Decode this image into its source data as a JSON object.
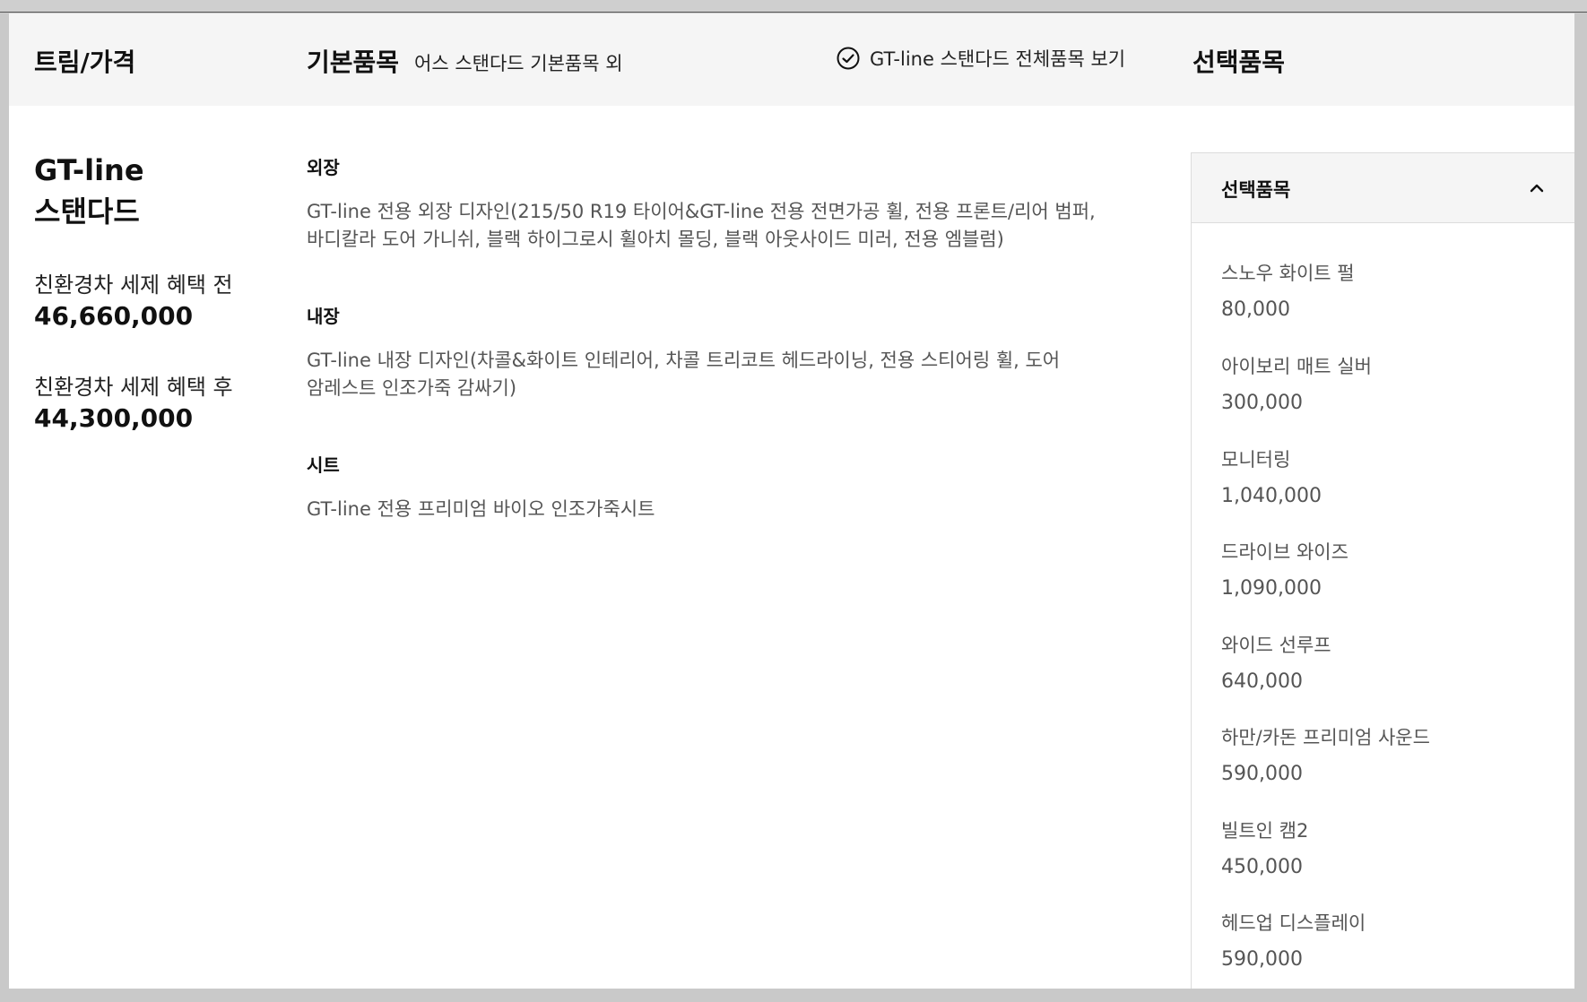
{
  "header": {
    "trim_price": "트림/가격",
    "basic_items": "기본품목",
    "basic_items_sub": "어스 스탠다드 기본품목 외",
    "view_all": "GT-line 스탠다드 전체품목 보기",
    "optional_items": "선택품목"
  },
  "trim": {
    "name_line1": "GT-line",
    "name_line2": "스탠다드",
    "before_label": "친환경차 세제 혜택 전",
    "before_price": "46,660,000",
    "after_label": "친환경차 세제 혜택 후",
    "after_price": "44,300,000"
  },
  "basic": {
    "categories": [
      {
        "title": "외장",
        "line1": "GT-line 전용 외장 디자인(215/50 R19 타이어&GT-line 전용 전면가공 휠, 전용 프론트/리어 범퍼,",
        "line2": "바디칼라 도어 가니쉬, 블랙 하이그로시 휠아치 몰딩, 블랙 아웃사이드 미러, 전용 엠블럼)"
      },
      {
        "title": "내장",
        "line1": "GT-line 내장 디자인(차콜&화이트 인테리어, 차콜 트리코트 헤드라이닝, 전용 스티어링 휠, 도어",
        "line2": "암레스트 인조가죽 감싸기)"
      },
      {
        "title": "시트",
        "line1": "GT-line 전용 프리미엄 바이오 인조가죽시트",
        "line2": ""
      }
    ]
  },
  "options": {
    "title": "선택품목",
    "items": [
      {
        "name": "스노우 화이트 펄",
        "price": "80,000"
      },
      {
        "name": "아이보리 매트 실버",
        "price": "300,000"
      },
      {
        "name": "모니터링",
        "price": "1,040,000"
      },
      {
        "name": "드라이브 와이즈",
        "price": "1,090,000"
      },
      {
        "name": "와이드 선루프",
        "price": "640,000"
      },
      {
        "name": "하만/카돈 프리미엄 사운드",
        "price": "590,000"
      },
      {
        "name": "빌트인 캠2",
        "price": "450,000"
      },
      {
        "name": "헤드업 디스플레이",
        "price": "590,000"
      }
    ]
  },
  "icons": {
    "view_all": "check-circle-icon",
    "collapse": "chevron-up-icon"
  }
}
